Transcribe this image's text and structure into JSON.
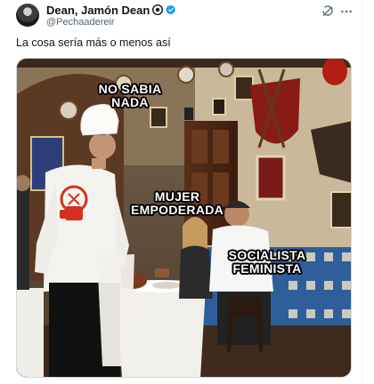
{
  "post": {
    "display_name": "Dean, Jamón Dean",
    "handle": "@Pechaadereir",
    "text": "La cosa sería más o menos así",
    "verified_color": "#1d9bf0"
  },
  "meme": {
    "labels": [
      {
        "text": "NO SABIA\nNADA"
      },
      {
        "text": "MUJER\nEMPODERADA"
      },
      {
        "text": "SOCIALISTA\nFEMINISTA"
      }
    ]
  },
  "icons": {
    "avatar": "avatar",
    "verified": "verified-badge-icon",
    "meta_badge": "dark-circle-badge-icon",
    "grok": "grok-icon",
    "more": "more-options-icon"
  }
}
